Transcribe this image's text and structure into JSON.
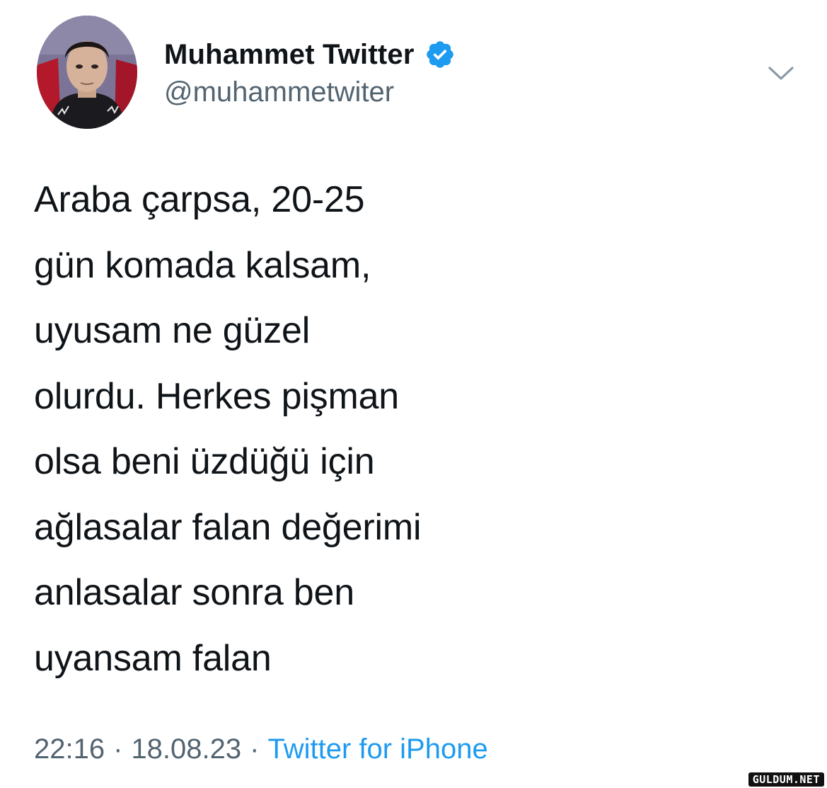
{
  "tweet": {
    "author": {
      "display_name": "Muhammet Twitter",
      "handle": "@muhammetwiter",
      "verified": true,
      "avatar_icon": "profile-photo"
    },
    "text_lines": [
      "Araba çarpsa, 20-25",
      "gün komada kalsam,",
      "uyusam ne güzel",
      "olurdu. Herkes pişman",
      "olsa beni üzdüğü için",
      "ağlasalar falan değerimi",
      "anlasalar sonra ben",
      "uyansam falan"
    ],
    "time": "22:16",
    "separator": "·",
    "date": "18.08.23",
    "source": "Twitter for iPhone"
  },
  "watermark": "GULDUM.NET",
  "colors": {
    "text": "#0f1419",
    "secondary": "#536471",
    "link": "#1d9bf0",
    "verified": "#1d9bf0",
    "background": "#ffffff"
  }
}
